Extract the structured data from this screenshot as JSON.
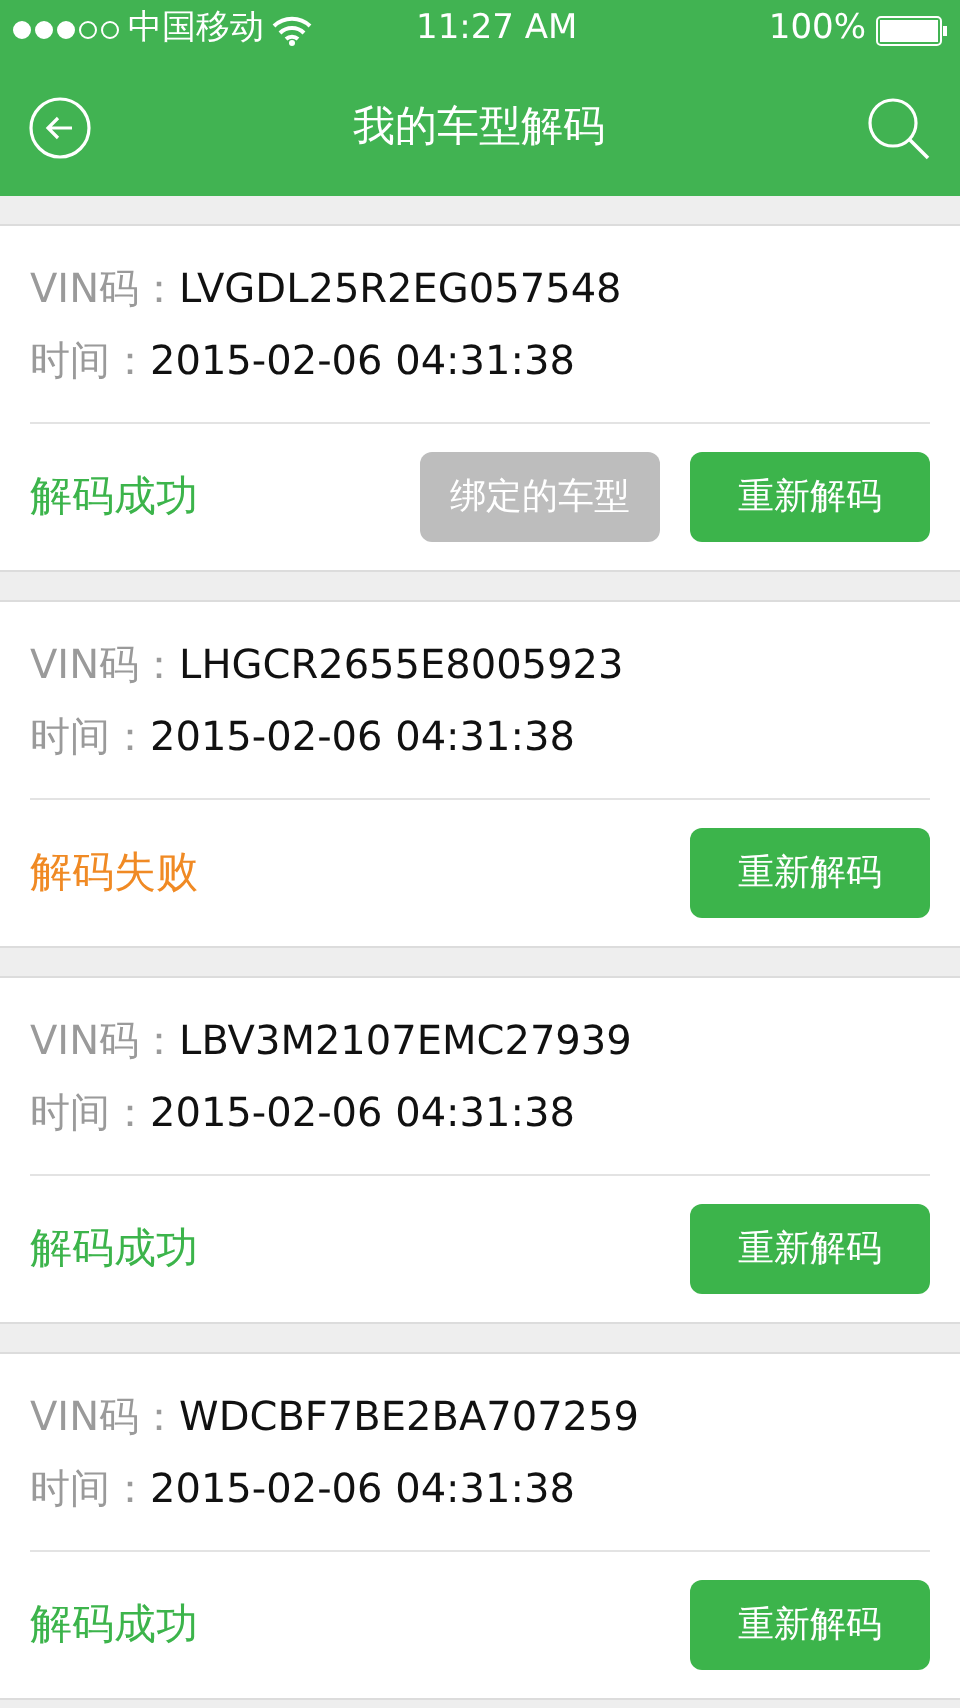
{
  "status_bar": {
    "carrier": "中国移动",
    "time": "11:27 AM",
    "battery": "100%"
  },
  "nav": {
    "title": "我的车型解码"
  },
  "records": [
    {
      "vin_label": "VIN码：",
      "vin": "LVGDL25R2EG057548",
      "time_label": "时间：",
      "time": "2015-02-06 04:31:38",
      "status": {
        "kind": "success",
        "text": "解码成功"
      },
      "bind_button": {
        "label": "绑定的车型",
        "disabled": true
      },
      "redecode_button": "重新解码"
    },
    {
      "vin_label": "VIN码：",
      "vin": "LHGCR2655E8005923",
      "time_label": "时间：",
      "time": "2015-02-06 04:31:38",
      "status": {
        "kind": "failure",
        "text": "解码失败"
      },
      "redecode_button": "重新解码"
    },
    {
      "vin_label": "VIN码：",
      "vin": "LBV3M2107EMC27939",
      "time_label": "时间：",
      "time": "2015-02-06 04:31:38",
      "status": {
        "kind": "success",
        "text": "解码成功"
      },
      "redecode_button": "重新解码"
    },
    {
      "vin_label": "VIN码：",
      "vin": "WDCBF7BE2BA707259",
      "time_label": "时间：",
      "time": "2015-02-06 04:31:38",
      "status": {
        "kind": "success",
        "text": "解码成功"
      },
      "redecode_button": "重新解码"
    }
  ]
}
